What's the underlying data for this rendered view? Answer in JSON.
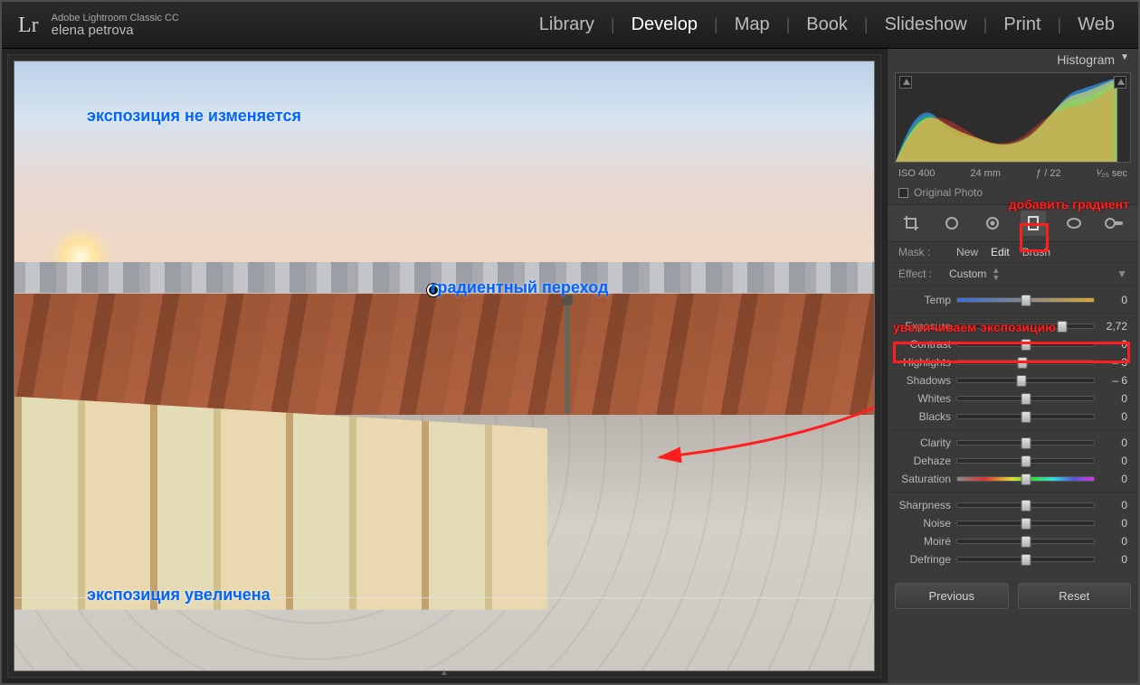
{
  "header": {
    "logo": "Lr",
    "product": "Adobe Lightroom Classic CC",
    "user": "elena petrova",
    "modules": [
      "Library",
      "Develop",
      "Map",
      "Book",
      "Slideshow",
      "Print",
      "Web"
    ],
    "active_module": "Develop"
  },
  "canvas_annotations": {
    "no_change": "экспозиция не изменяется",
    "gradient": "градиентный переход",
    "increased": "экспозиция увеличена"
  },
  "right": {
    "histogram_title": "Histogram",
    "exif": {
      "iso": "ISO 400",
      "focal": "24 mm",
      "aperture": "ƒ / 22",
      "shutter": "¹⁄₂₅ sec"
    },
    "original_photo": "Original Photo",
    "mask_label": "Mask :",
    "mask_modes": {
      "new": "New",
      "edit": "Edit",
      "brush": "Brush"
    },
    "effect_label": "Effect :",
    "effect_value": "Custom",
    "annotations": {
      "add_gradient": "добавить градиент",
      "increase_exposure": "увеличиваем экспозицию"
    },
    "sliders": [
      {
        "group": 0,
        "name": "Temp",
        "value": "0",
        "pos": 50,
        "track": "temp"
      },
      {
        "group": 1,
        "name": "Exposure",
        "value": "2,72",
        "pos": 77
      },
      {
        "group": 1,
        "name": "Contrast",
        "value": "0",
        "pos": 50
      },
      {
        "group": 1,
        "name": "Highlights",
        "value": "– 3",
        "pos": 48
      },
      {
        "group": 1,
        "name": "Shadows",
        "value": "– 6",
        "pos": 47
      },
      {
        "group": 1,
        "name": "Whites",
        "value": "0",
        "pos": 50
      },
      {
        "group": 1,
        "name": "Blacks",
        "value": "0",
        "pos": 50
      },
      {
        "group": 2,
        "name": "Clarity",
        "value": "0",
        "pos": 50
      },
      {
        "group": 2,
        "name": "Dehaze",
        "value": "0",
        "pos": 50
      },
      {
        "group": 2,
        "name": "Saturation",
        "value": "0",
        "pos": 50,
        "track": "sat"
      },
      {
        "group": 3,
        "name": "Sharpness",
        "value": "0",
        "pos": 50
      },
      {
        "group": 3,
        "name": "Noise",
        "value": "0",
        "pos": 50
      },
      {
        "group": 3,
        "name": "Moiré",
        "value": "0",
        "pos": 50
      },
      {
        "group": 3,
        "name": "Defringe",
        "value": "0",
        "pos": 50
      }
    ],
    "buttons": {
      "previous": "Previous",
      "reset": "Reset"
    }
  }
}
